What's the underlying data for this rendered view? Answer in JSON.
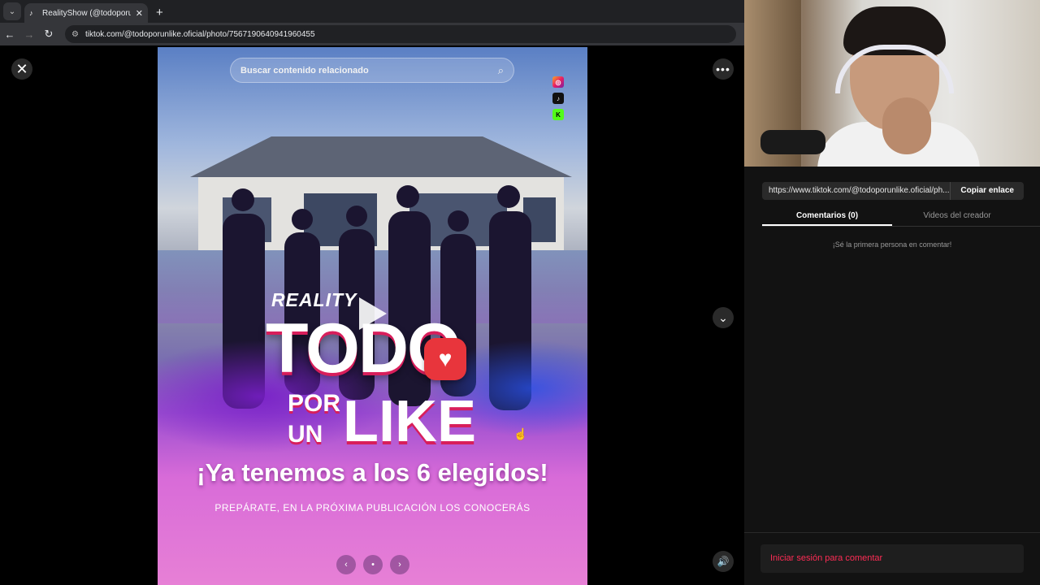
{
  "browser": {
    "tab_title": "RealityShow (@todoporunlike.o",
    "tab_favicon": "♪",
    "new_tab": "+",
    "url": "tiktok.com/@todoporunlike.oficial/photo/7567190640941960455"
  },
  "viewer": {
    "search_placeholder": "Buscar contenido relacionado",
    "close_glyph": "✕",
    "more_glyph": "•••",
    "down_glyph": "⌄",
    "volume_glyph": "🔊"
  },
  "poster": {
    "reality": "REALITY",
    "todo": "TODO",
    "por": "POR",
    "un": "UN",
    "like": "LIKE",
    "headline": "¡Ya tenemos a los 6 elegidos!",
    "subline": "PREPÁRATE, EN LA PRÓXIMA PUBLICACIÓN LOS CONOCERÁS",
    "pager_prev": "‹",
    "pager_dot": "•",
    "pager_next": "›",
    "social_icons": [
      "instagram-icon",
      "tiktok-icon",
      "kick-icon"
    ]
  },
  "side": {
    "share_url": "https://www.tiktok.com/@todoporunlike.oficial/ph...",
    "copy_label": "Copiar enlace",
    "tab_comments": "Comentarios (0)",
    "tab_creator": "Videos del creador",
    "empty_text": "¡Sé la primera persona en comentar!",
    "login_label": "Iniciar sesión para comentar"
  },
  "colors": {
    "accent": "#fe2c55",
    "poster_red": "#d81e5b",
    "heart_bubble": "#e8353c"
  }
}
